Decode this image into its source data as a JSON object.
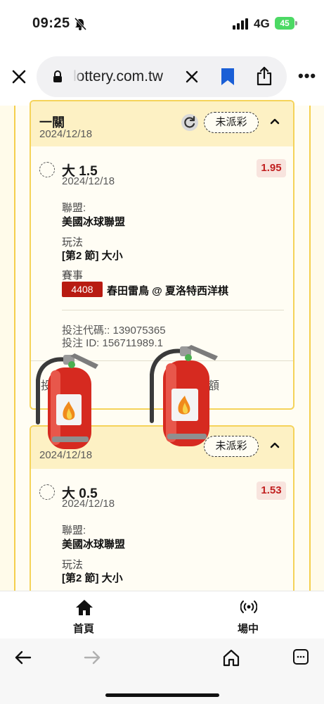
{
  "status_bar": {
    "time": "09:25",
    "network": "4G",
    "battery": "45"
  },
  "browser": {
    "url": "lottery.com.tw"
  },
  "card1": {
    "title": "一關",
    "date": "2024/12/18",
    "status": "未派彩",
    "bet": {
      "selection": "大 1.5",
      "date": "2024/12/18",
      "odds": "1.95",
      "league_label": "聯盟:",
      "league": "美國冰球聯盟",
      "market_label": "玩法",
      "market": "[第2 節] 大小",
      "event_label": "賽事",
      "event_id": "4408",
      "event_name": "春田雷鳥 @ 夏洛特西洋棋",
      "ticket_code": "投注代碼:: 139075365",
      "ticket_id": "投注 ID: 156711989.1"
    },
    "footer_left": "投",
    "footer_right": "額"
  },
  "card2": {
    "date": "2024/12/18",
    "status": "未派彩",
    "bet": {
      "selection": "大 0.5",
      "date": "2024/12/18",
      "odds": "1.53",
      "league_label": "聯盟:",
      "league": "美國冰球聯盟",
      "market_label": "玩法",
      "market": "[第2 節] 大小"
    }
  },
  "bottom_nav": [
    {
      "label": "首頁",
      "icon": "home-icon"
    },
    {
      "label": "場中",
      "icon": "live-broadcast-icon"
    }
  ],
  "overlay_icons": [
    "fire-extinguisher-icon",
    "fire-extinguisher-icon"
  ]
}
